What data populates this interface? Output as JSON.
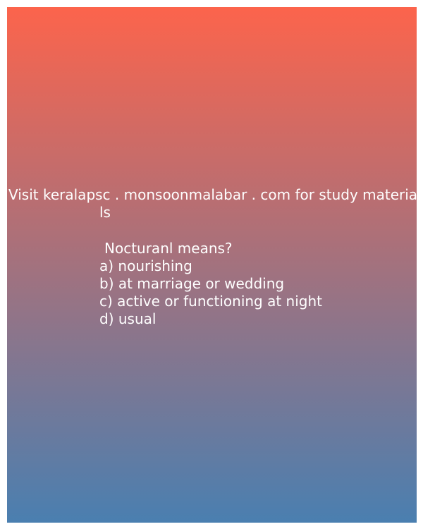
{
  "promo": {
    "line1": "Visit keralapsc . monsoonmalabar . com for study materia",
    "line2": "ls"
  },
  "question": {
    "text": "Nocturanl means?",
    "options": [
      "a) nourishing",
      "b) at marriage or wedding",
      "c) active or functioning at night",
      "d) usual"
    ]
  },
  "colors": {
    "gradient_top": "#fc644c",
    "gradient_bottom": "#4a7fb0",
    "text": "#ffffff"
  }
}
